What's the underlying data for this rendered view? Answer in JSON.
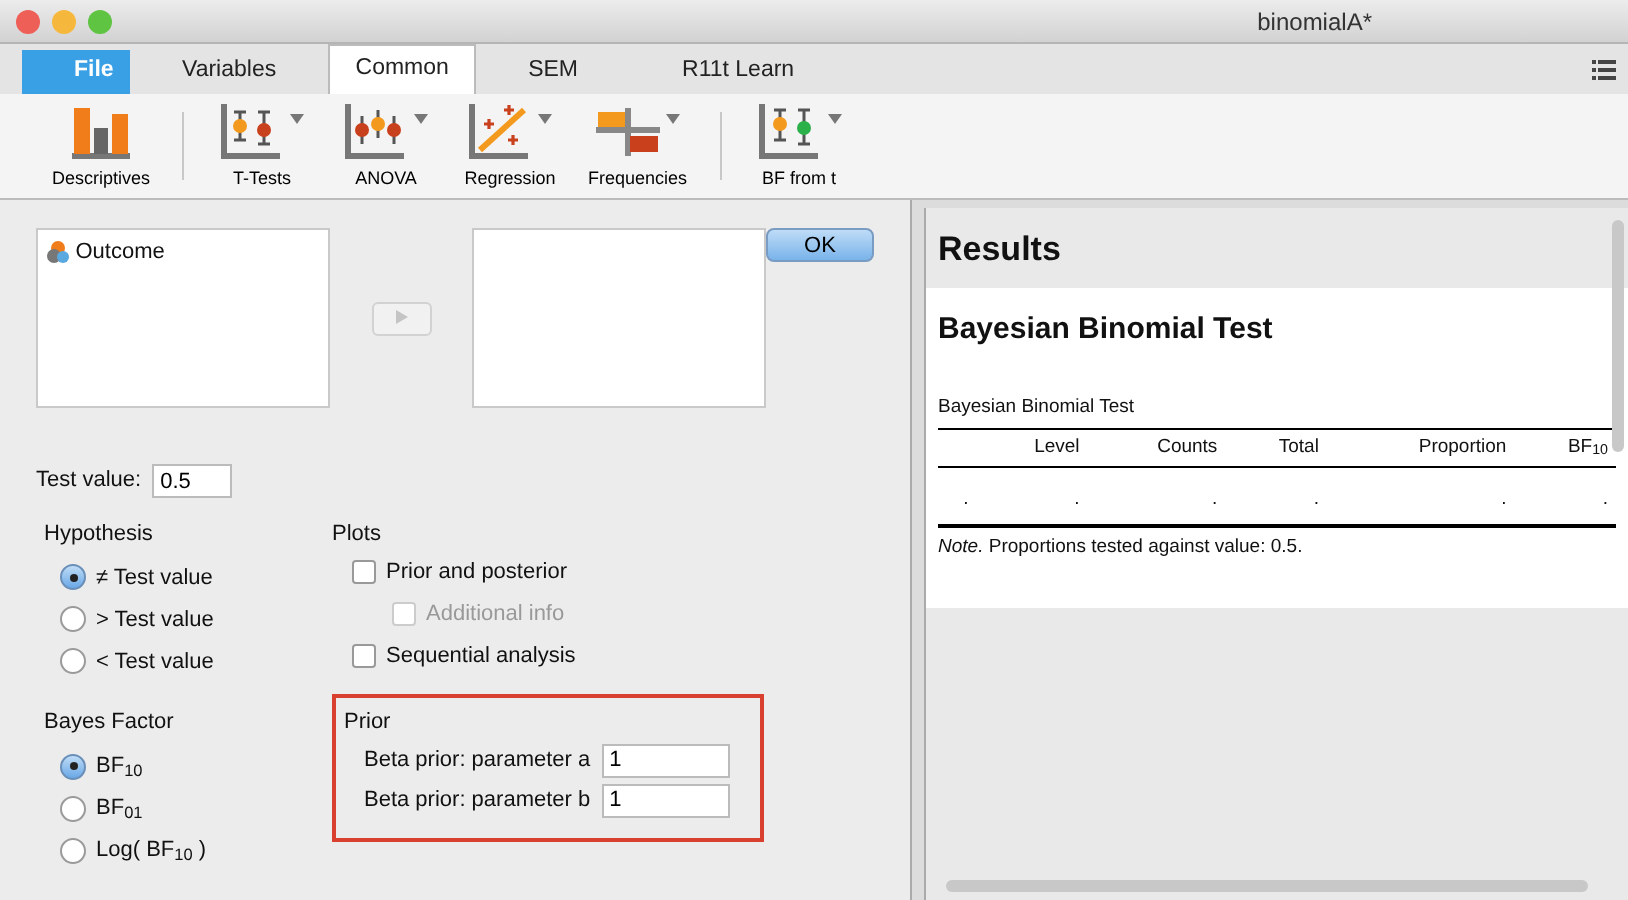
{
  "window": {
    "title": "binomialA*"
  },
  "tabs": [
    {
      "label": "File",
      "kind": "file",
      "selected": false
    },
    {
      "label": "Variables",
      "kind": "tab",
      "selected": false
    },
    {
      "label": "Common",
      "kind": "tab",
      "selected": true
    },
    {
      "label": "SEM",
      "kind": "tab",
      "selected": false
    },
    {
      "label": "R11t Learn",
      "kind": "tab",
      "selected": false
    }
  ],
  "toolbar": [
    {
      "label": "Descriptives",
      "kind": "bars",
      "dropdown": false
    },
    {
      "label": "T-Tests",
      "kind": "ttest",
      "dropdown": true
    },
    {
      "label": "ANOVA",
      "kind": "anova",
      "dropdown": true
    },
    {
      "label": "Regression",
      "kind": "regression",
      "dropdown": true
    },
    {
      "label": "Frequencies",
      "kind": "frequencies",
      "dropdown": true
    },
    {
      "label": "BF from t",
      "kind": "bf",
      "dropdown": true
    }
  ],
  "variables": {
    "source": [
      {
        "label": "Outcome"
      }
    ],
    "ok_button": "OK"
  },
  "test_value": {
    "label": "Test value:",
    "value": "0.5"
  },
  "hypothesis": {
    "title": "Hypothesis",
    "options": [
      {
        "label": "≠ Test value",
        "selected": true
      },
      {
        "label": "> Test value",
        "selected": false
      },
      {
        "label": "< Test value",
        "selected": false
      }
    ]
  },
  "bayes_factor": {
    "title": "Bayes Factor",
    "options": [
      {
        "label": "BF$_{10}$",
        "selected": true
      },
      {
        "label": "BF$_{01}$",
        "selected": false
      },
      {
        "label": "Log( BF$_{10}$ )",
        "selected": false
      }
    ]
  },
  "plots": {
    "title": "Plots",
    "options": [
      {
        "label": "Prior and posterior",
        "checked": false,
        "disabled": false,
        "children": [
          {
            "label": "Additional info",
            "checked": false,
            "disabled": true
          }
        ]
      },
      {
        "label": "Sequential analysis",
        "checked": false,
        "disabled": false
      }
    ]
  },
  "prior": {
    "title": "Prior",
    "fields": [
      {
        "label": "Beta prior: parameter a",
        "value": "1"
      },
      {
        "label": "Beta prior: parameter b",
        "value": "1"
      }
    ]
  },
  "results": {
    "title": "Results",
    "analysis_title": "Bayesian Binomial Test",
    "table": {
      "caption": "Bayesian Binomial Test",
      "columns": [
        "",
        "Level",
        "Counts",
        "Total",
        "Proportion",
        "BF$_{10}$"
      ],
      "rows": [
        [
          ".",
          ".",
          ".",
          ".",
          ".",
          "."
        ]
      ],
      "note": "*Note.* Proportions tested against value: 0.5."
    }
  }
}
